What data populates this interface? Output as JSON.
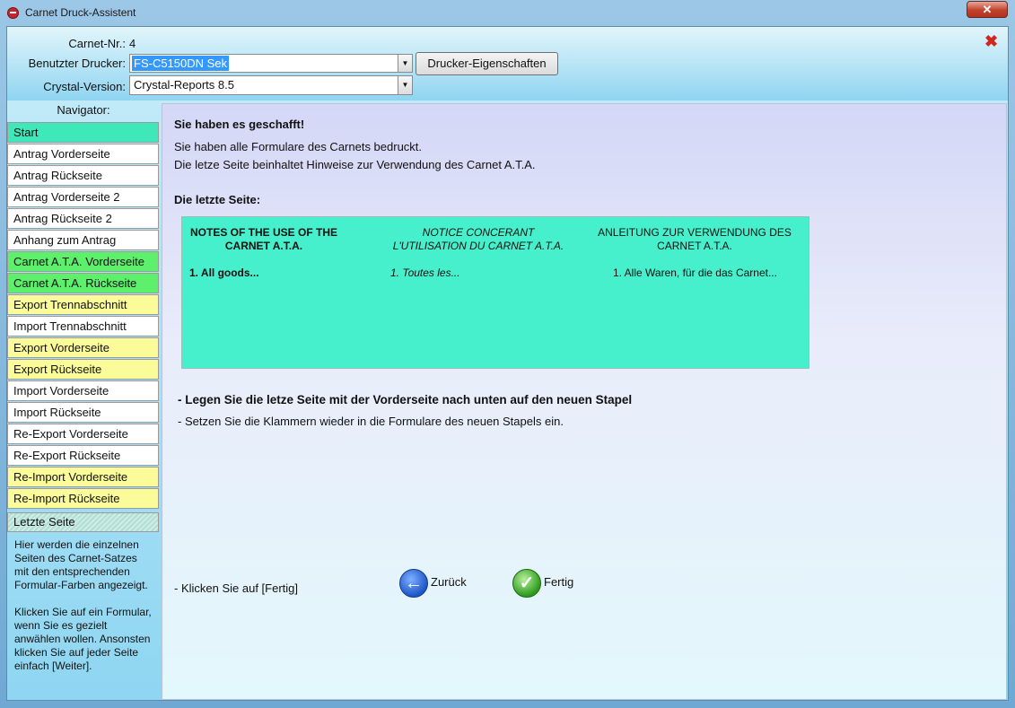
{
  "window": {
    "title": "Carnet Druck-Assistent",
    "close_glyph": "✕"
  },
  "header": {
    "carnet_label": "Carnet-Nr.:",
    "carnet_value": "4",
    "printer_label": "Benutzter Drucker:",
    "printer_value": "FS-C5150DN Sek",
    "printer_props_button": "Drucker-Eigenschaften",
    "crystal_label": "Crystal-Version:",
    "crystal_value": "Crystal-Reports 8.5",
    "close_icon": "✖"
  },
  "navigator": {
    "title": "Navigator:",
    "items": [
      {
        "label": "Start",
        "color": "#3fe8b8"
      },
      {
        "label": "Antrag Vorderseite",
        "color": "#ffffff"
      },
      {
        "label": "Antrag Rückseite",
        "color": "#ffffff"
      },
      {
        "label": "Antrag Vorderseite 2",
        "color": "#ffffff"
      },
      {
        "label": "Antrag Rückseite 2",
        "color": "#ffffff"
      },
      {
        "label": "Anhang zum Antrag",
        "color": "#ffffff"
      },
      {
        "label": "Carnet A.T.A. Vorderseite",
        "color": "#5cf06b"
      },
      {
        "label": "Carnet A.T.A. Rückseite",
        "color": "#5cf06b"
      },
      {
        "label": "Export Trennabschnitt",
        "color": "#fbfb9a"
      },
      {
        "label": "Import Trennabschnitt",
        "color": "#ffffff"
      },
      {
        "label": "Export Vorderseite",
        "color": "#fbfb9a"
      },
      {
        "label": "Export Rückseite",
        "color": "#fbfb9a"
      },
      {
        "label": "Import Vorderseite",
        "color": "#ffffff"
      },
      {
        "label": "Import Rückseite",
        "color": "#ffffff"
      },
      {
        "label": "Re-Export Vorderseite",
        "color": "#ffffff"
      },
      {
        "label": "Re-Export Rückseite",
        "color": "#ffffff"
      },
      {
        "label": "Re-Import Vorderseite",
        "color": "#fbfb9a"
      },
      {
        "label": "Re-Import Rückseite",
        "color": "#fbfb9a"
      }
    ],
    "current": "Letzte Seite",
    "help_p1": "Hier werden die einzelnen Seiten des Carnet-Satzes mit den entsprechenden Formular-Farben angezeigt.",
    "help_p2": "Klicken Sie auf ein Formular, wenn Sie es gezielt anwählen wollen. Ansonsten klicken Sie auf jeder Seite einfach [Weiter]."
  },
  "main": {
    "heading": "Sie haben es geschafft!",
    "line1": "Sie haben alle Formulare des Carnets bedruckt.",
    "line2": "Die letze Seite beinhaltet Hinweise zur Verwendung des Carnet A.T.A.",
    "section_title": "Die letzte Seite:",
    "notes": {
      "en_title": "NOTES OF THE USE OF THE CARNET A.T.A.",
      "en_item": "1. All goods...",
      "fr_title": "NOTICE CONCERANT L'UTILISATION DU CARNET A.T.A.",
      "fr_item": "1. Toutes les...",
      "de_title": "ANLEITUNG ZUR VERWENDUNG DES CARNET A.T.A.",
      "de_item": "1. Alle Waren, für die das Carnet..."
    },
    "instruction1": "- Legen Sie die letze Seite mit der Vorderseite nach unten auf den neuen Stapel",
    "instruction2": "- Setzen Sie die Klammern wieder in die Formulare des neuen Stapels ein.",
    "click_hint": "- Klicken Sie auf [Fertig]",
    "back_label": "Zurück",
    "back_icon": "arrow-left-icon",
    "finish_label": "Fertig",
    "finish_icon": "checkmark-icon"
  }
}
